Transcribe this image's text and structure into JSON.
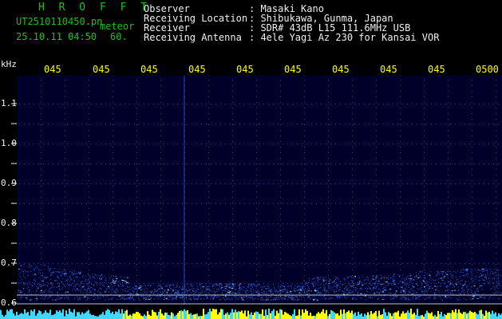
{
  "header": {
    "title": "H R O F F T",
    "filename": "UT2510110450.pn",
    "mode": "meteor",
    "datetime": "25.10.11 04:50",
    "count": "60."
  },
  "info": [
    {
      "label": "Observer",
      "value": ": Masaki Kano"
    },
    {
      "label": "Receiving Location",
      "value": ": Shibukawa, Gunma, Japan"
    },
    {
      "label": "Receiver",
      "value": ": SDR# 43dB L15 111.6MHz USB"
    },
    {
      "label": "Receiving Antenna",
      "value": ": 4ele Yagi Az 230 for Kansai VOR"
    }
  ],
  "axis": {
    "unit": "kHz",
    "y_ticks": [
      "1.1",
      "1.0",
      "0.9",
      "0.8",
      "0.7",
      "0.6"
    ],
    "x_ticks": [
      "045",
      "045",
      "045",
      "045",
      "045",
      "045",
      "045",
      "045",
      "045",
      "0500"
    ]
  },
  "colors": {
    "background": "#000000",
    "plot_background": "#00002a",
    "grid": "#3a3a8a",
    "signal": "#2f7dff",
    "signal_hot": "#9fe8ff",
    "yellow": "#ffff00",
    "cyan": "#3fd9ff"
  }
}
